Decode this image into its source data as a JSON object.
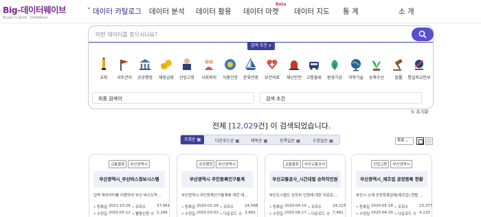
{
  "logo": {
    "main": "Big-데이터웨이브",
    "sub": "Busan is good · DataWave"
  },
  "nav": [
    {
      "label": "데이터 카탈로그"
    },
    {
      "label": "데이터 분석"
    },
    {
      "label": "데이터 활용"
    },
    {
      "label": "데이터 마켓"
    },
    {
      "label": "데이터 지도"
    },
    {
      "label": "통 계"
    },
    {
      "label": "소 개"
    }
  ],
  "nav_beta": "Beta",
  "search": {
    "placeholder": "어떤 데이터를 찾으시나요?",
    "condition_label": "검색 조건 ∨"
  },
  "categories": [
    {
      "label": "교육",
      "icon": "education-icon",
      "color": "#f2a41f"
    },
    {
      "label": "국토관리",
      "icon": "land-icon",
      "color": "#c0392b"
    },
    {
      "label": "공공행정",
      "icon": "government-icon",
      "color": "#4a6fa5"
    },
    {
      "label": "재정금융",
      "icon": "coins-icon",
      "color": "#f2b71f"
    },
    {
      "label": "산업고용",
      "icon": "industry-icon",
      "color": "#2d3e7a"
    },
    {
      "label": "사회복지",
      "icon": "welfare-icon",
      "color": "#d9534f"
    },
    {
      "label": "식품건강",
      "icon": "food-icon",
      "color": "#3b7bbf"
    },
    {
      "label": "문화관광",
      "icon": "culture-icon",
      "color": "#2d5fa0"
    },
    {
      "label": "보건의료",
      "icon": "medical-icon",
      "color": "#d9534f"
    },
    {
      "label": "재난안전",
      "icon": "siren-icon",
      "color": "#c0392b"
    },
    {
      "label": "교통물류",
      "icon": "car-icon",
      "color": "#2d3e7a"
    },
    {
      "label": "환경기상",
      "icon": "environment-icon",
      "color": "#27ae60"
    },
    {
      "label": "과학기술",
      "icon": "globe-icon",
      "color": "#2d5fa0"
    },
    {
      "label": "농축수산",
      "icon": "plant-icon",
      "color": "#27ae60"
    },
    {
      "label": "법률",
      "icon": "gavel-icon",
      "color": "#8a5a2b"
    },
    {
      "label": "통일외교안보",
      "icon": "security-icon",
      "color": "#2d3e7a"
    }
  ],
  "filters": {
    "recent": "최종 검색어",
    "condition": "검색 조건"
  },
  "reset_label": "초기화",
  "result": {
    "prefix": "전체 [",
    "count": "12,029",
    "suffix": "건] 이 검색되었습니다."
  },
  "sort": [
    {
      "label": "조회순 ▦"
    },
    {
      "label": "다운로드순 ▦"
    },
    {
      "label": "제목순 ▦"
    },
    {
      "label": "등록일순 ▦"
    },
    {
      "label": "수정일순 ▦"
    }
  ],
  "view_select": "목록 ⌄",
  "cards": [
    {
      "tags": [
        "교통물류",
        "부산광역시"
      ],
      "title": "부산광역시_부산버스정보시스템",
      "desc": "입력 파라미터를 이용하여 부산 버스도착...",
      "meta": [
        {
          "k1": "• 등록일",
          "v1": "2021-10-26",
          "k2": "• 조회수",
          "v2": "37,941"
        },
        {
          "k1": "• 수정일",
          "v1": "2025-05-12",
          "k2": "• 활용신청 수",
          "v2": "1,166"
        }
      ]
    },
    {
      "tags": [
        "공공행정",
        "부산광역시"
      ],
      "title": "부산광역시 주민등록인구통계",
      "desc": "부산광역시 주민등록인구통계에 대한 데...",
      "meta": [
        {
          "k1": "• 등록일",
          "v1": "2020-02-28",
          "k2": "• 조회수",
          "v2": "24,568"
        },
        {
          "k1": "• 수정일",
          "v1": "2025-03-03",
          "k2": "• 다운로드 수",
          "v2": "3,962"
        }
      ]
    },
    {
      "tags": [
        "교통물류",
        "부산교통공사"
      ],
      "title": "부산교통공사_시간대별 승하차인원",
      "desc": "부산도시철도 승하차 인원에 대한 자료로,...",
      "meta": [
        {
          "k1": "• 등록일",
          "v1": "2020-04-14",
          "k2": "• 조회수",
          "v2": "24,223"
        },
        {
          "k1": "• 수정일",
          "v1": "2025-06-17",
          "k2": "• 다운로드 수",
          "v2": "7,481"
        }
      ]
    },
    {
      "tags": [
        "산업고용",
        "부산광역시"
      ],
      "title": "부산광역시_제조업 공장등록 현황",
      "desc": "부산시 소재 공장등록업체(제조업) 현황 ...",
      "meta": [
        {
          "k1": "• 등록일",
          "v1": "2020-05-18",
          "k2": "• 조회수",
          "v2": "23,377"
        },
        {
          "k1": "• 수정일",
          "v1": "2025-04-30",
          "k2": "• 다운로드 수",
          "v2": "4,133"
        }
      ]
    }
  ]
}
